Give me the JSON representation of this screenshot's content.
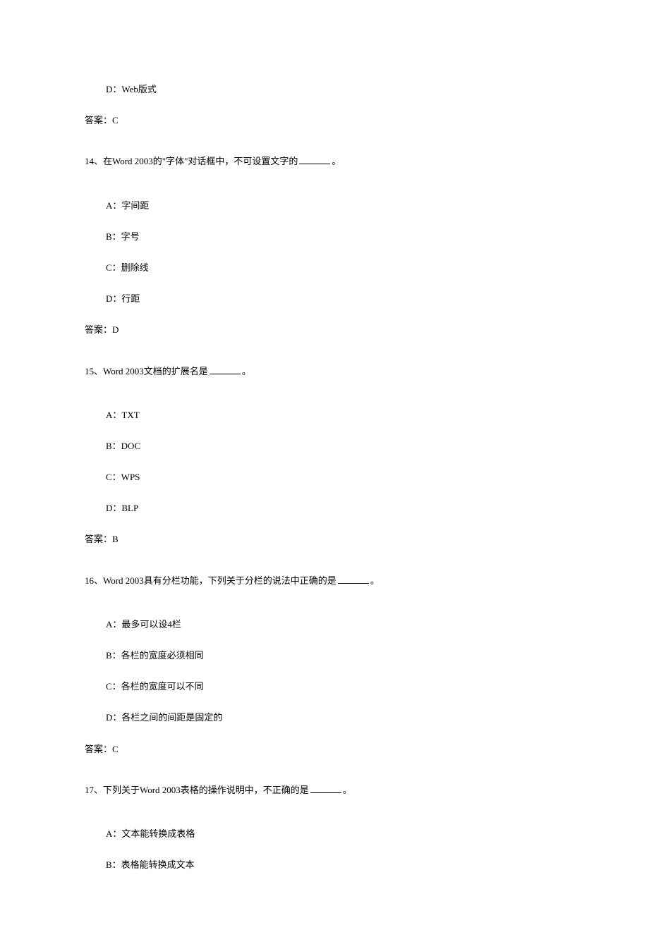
{
  "prev_trailing": {
    "option_d": "D：Web版式",
    "answer": "答案：C"
  },
  "q14": {
    "prompt_pre": "14、在Word 2003的\"字体\"对话框中，不可设置文字的",
    "prompt_post": "。",
    "a": "A：字间距",
    "b": "B：字号",
    "c": "C：删除线",
    "d": "D：行距",
    "answer": "答案：D"
  },
  "q15": {
    "prompt_pre": "15、Word 2003文档的扩展名是",
    "prompt_post": "。",
    "a": "A：TXT",
    "b": "B：DOC",
    "c": "C：WPS",
    "d": "D：BLP",
    "answer": "答案：B"
  },
  "q16": {
    "prompt_pre": "16、Word 2003具有分栏功能，下列关于分栏的说法中正确的是",
    "prompt_post": "。",
    "a": "A：最多可以设4栏",
    "b": "B：各栏的宽度必须相同",
    "c": "C：各栏的宽度可以不同",
    "d": "D：各栏之间的间距是固定的",
    "answer": "答案：C"
  },
  "q17": {
    "prompt_pre": "17、下列关于Word 2003表格的操作说明中，不正确的是",
    "prompt_post": "。",
    "a": "A：文本能转换成表格",
    "b": "B：表格能转换成文本"
  }
}
